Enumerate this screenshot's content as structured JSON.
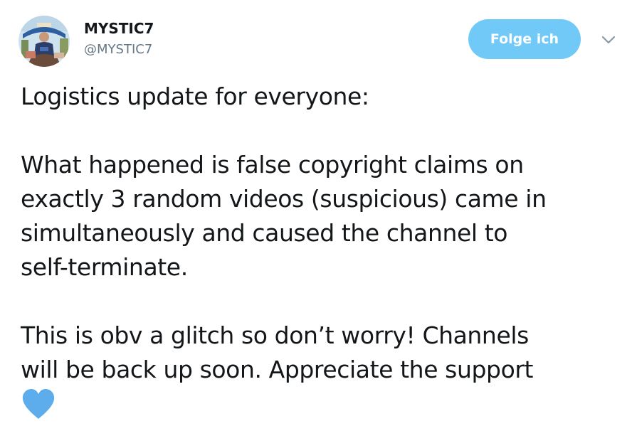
{
  "author": {
    "display_name": "MYSTIC7",
    "handle": "@MYSTIC7",
    "avatar_icon": "profile-photo"
  },
  "actions": {
    "follow_label": "Folge ich",
    "follow_color": "#71c9f8",
    "more_icon": "chevron-down-icon"
  },
  "tweet": {
    "lines_para1": [
      "Logistics update for everyone:"
    ],
    "lines_para2": [
      "What happened is false copyright claims on",
      "exactly 3 random videos (suspicious) came in",
      "simultaneously and caused the channel to",
      "self-terminate."
    ],
    "lines_para3": [
      "This is obv a glitch so don’t worry! Channels",
      "will be back up soon. Appreciate the support"
    ],
    "emoji": "blue-heart-icon",
    "emoji_color": "#5dadec"
  }
}
